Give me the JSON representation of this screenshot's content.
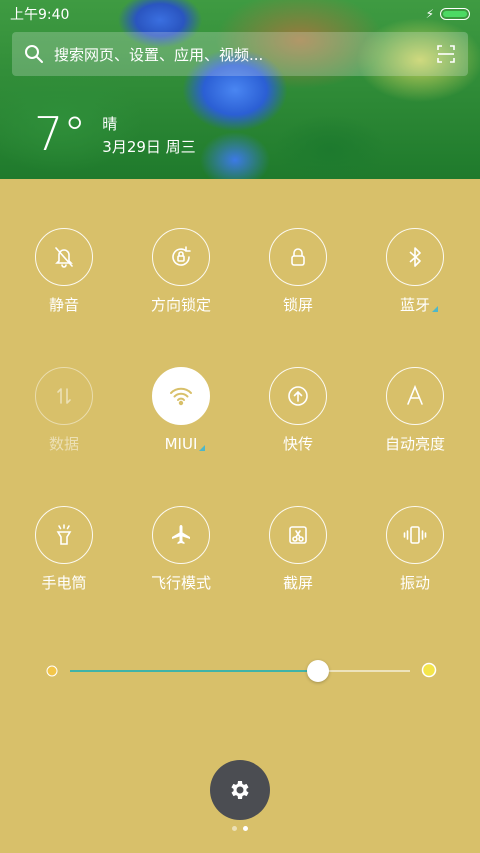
{
  "status_bar": {
    "time": "上午9:40",
    "battery_level": 1.0,
    "charging": true
  },
  "search": {
    "placeholder": "搜索网页、设置、应用、视频..."
  },
  "weather": {
    "temperature": "7°",
    "condition": "晴",
    "date": "3月29日 周三"
  },
  "toggles": [
    {
      "id": "mute",
      "label": "静音",
      "icon": "bell-off-icon",
      "state": "off"
    },
    {
      "id": "rotation-lock",
      "label": "方向锁定",
      "icon": "rotation-lock-icon",
      "state": "off"
    },
    {
      "id": "lock-screen",
      "label": "锁屏",
      "icon": "lock-icon",
      "state": "off"
    },
    {
      "id": "bluetooth",
      "label": "蓝牙",
      "icon": "bluetooth-icon",
      "state": "off",
      "expandable": true
    },
    {
      "id": "mobile-data",
      "label": "数据",
      "icon": "data-arrows-icon",
      "state": "disabled"
    },
    {
      "id": "wifi",
      "label": "MIUI",
      "icon": "wifi-icon",
      "state": "on",
      "expandable": true
    },
    {
      "id": "quick-share",
      "label": "快传",
      "icon": "upload-circle-icon",
      "state": "off"
    },
    {
      "id": "auto-brightness",
      "label": "自动亮度",
      "icon": "letter-a-icon",
      "state": "off"
    },
    {
      "id": "flashlight",
      "label": "手电筒",
      "icon": "flashlight-icon",
      "state": "off"
    },
    {
      "id": "airplane-mode",
      "label": "飞行模式",
      "icon": "airplane-icon",
      "state": "off"
    },
    {
      "id": "screenshot",
      "label": "截屏",
      "icon": "scissors-icon",
      "state": "off"
    },
    {
      "id": "vibrate",
      "label": "振动",
      "icon": "vibrate-icon",
      "state": "off"
    }
  ],
  "brightness": {
    "level": 0.73,
    "min_icon": "sun-dim-icon",
    "max_icon": "sun-bright-icon"
  },
  "settings_button": {
    "icon": "gear-icon"
  },
  "pager": {
    "pages": 2,
    "current": 2
  },
  "colors": {
    "panel_bg": "#d8c06a",
    "accent": "#3fb3a8",
    "settings_bg": "#4b4d52",
    "wifi_icon": "#d8c06a"
  }
}
